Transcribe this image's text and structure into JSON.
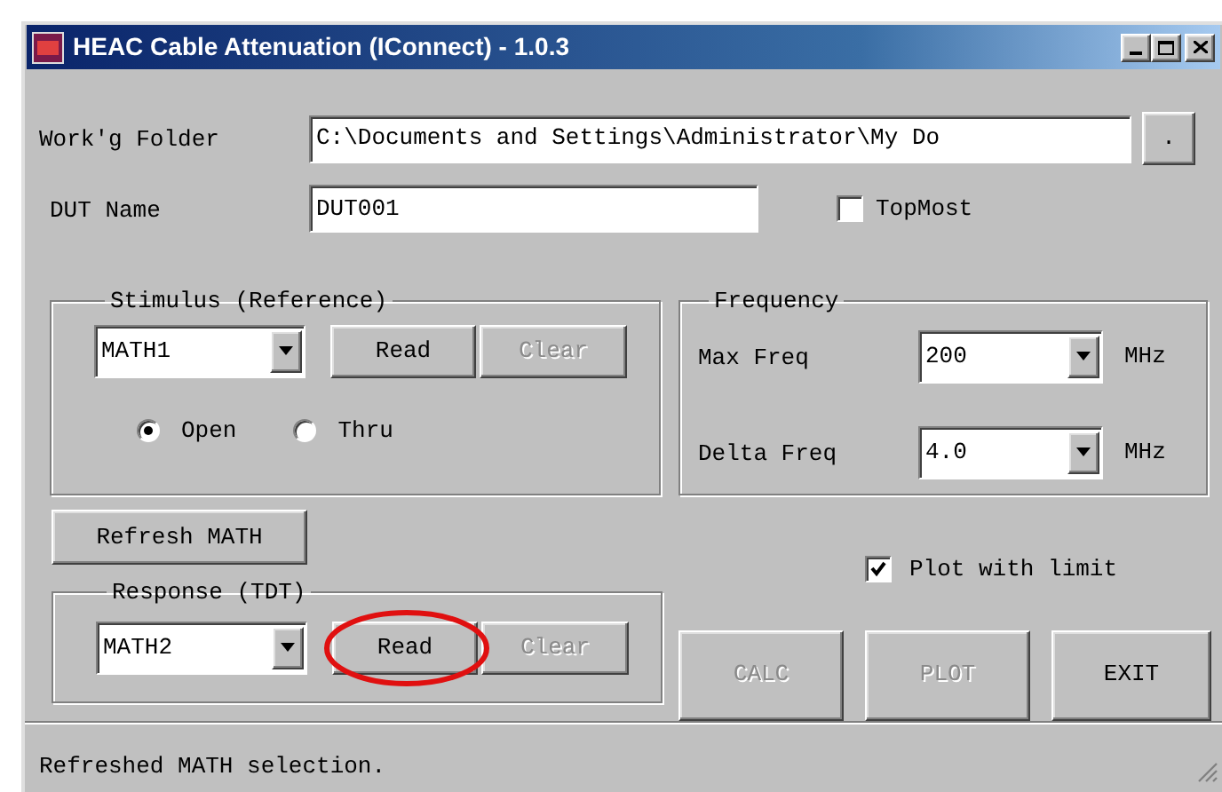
{
  "window": {
    "title": "HEAC Cable Attenuation (IConnect) - 1.0.3"
  },
  "folder": {
    "label": "Work'g Folder",
    "value": "C:\\Documents and Settings\\Administrator\\My Do",
    "browse": "."
  },
  "dut": {
    "label": "DUT Name",
    "value": "DUT001"
  },
  "topmost": {
    "label": "TopMost",
    "checked": false
  },
  "stimulus": {
    "title": "Stimulus (Reference)",
    "source": "MATH1",
    "read": {
      "label": "Read",
      "disabled": false,
      "circled": false
    },
    "clear": {
      "label": "Clear",
      "disabled": true
    },
    "radios": [
      {
        "label": "Open",
        "selected": true
      },
      {
        "label": "Thru",
        "selected": false
      }
    ]
  },
  "frequency": {
    "title": "Frequency",
    "rows": [
      {
        "label": "Max Freq",
        "value": "200",
        "unit": "MHz"
      },
      {
        "label": "Delta Freq",
        "value": "4.0",
        "unit": "MHz"
      }
    ]
  },
  "refresh_button": "Refresh MATH",
  "plot_limit": {
    "label": "Plot with limit",
    "checked": true
  },
  "response": {
    "title": "Response (TDT)",
    "source": "MATH2",
    "read": {
      "label": "Read",
      "disabled": false,
      "circled": true
    },
    "clear": {
      "label": "Clear",
      "disabled": true
    }
  },
  "actions": [
    {
      "label": "CALC",
      "disabled": true
    },
    {
      "label": "PLOT",
      "disabled": true
    },
    {
      "label": "EXIT",
      "disabled": false
    }
  ],
  "status_bar": {
    "text": "Refreshed MATH selection."
  }
}
